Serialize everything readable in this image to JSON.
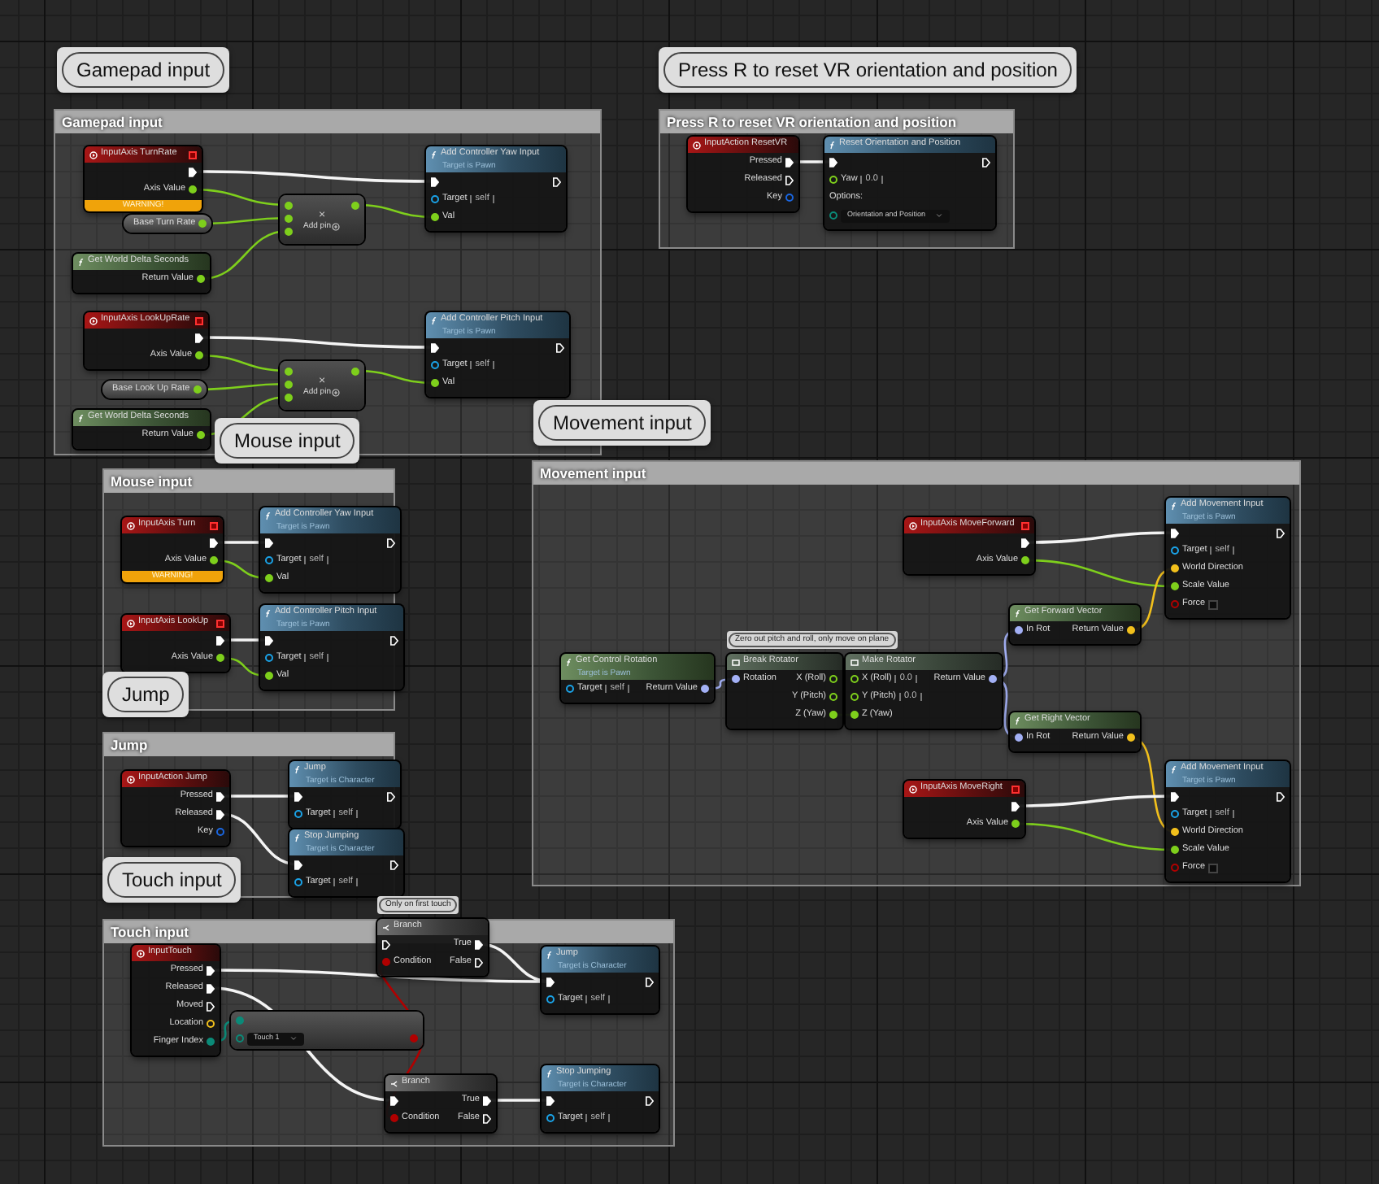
{
  "comments": [
    {
      "bubble": "Gamepad input",
      "title": "Gamepad input",
      "nodes": [
        {
          "kind": "event",
          "title": "InputAxis TurnRate",
          "delegate": true,
          "warning": "WARNING!",
          "rows": [
            {
              "out": {
                "kind": "exec",
                "linked": true
              }
            },
            {
              "out": {
                "kind": "float",
                "label": "Axis Value",
                "linked": true
              }
            }
          ]
        },
        {
          "kind": "getter",
          "title": "Base Turn Rate",
          "rows": [
            {
              "out": {
                "kind": "float",
                "linked": true
              }
            }
          ]
        },
        {
          "kind": "pure",
          "title": "Get World Delta Seconds",
          "rows": [
            {
              "out": {
                "kind": "float",
                "label": "Return Value",
                "linked": true
              }
            }
          ]
        },
        {
          "kind": "math",
          "symbol": "×",
          "action": "Add pin",
          "rows": [
            {
              "in": {
                "kind": "float",
                "linked": true
              },
              "out": {
                "kind": "float",
                "linked": true
              }
            },
            {
              "in": {
                "kind": "float",
                "linked": true
              }
            },
            {
              "in": {
                "kind": "float",
                "linked": true
              }
            }
          ]
        },
        {
          "kind": "function",
          "title": "Add Controller Yaw Input",
          "subtitle": "Target is Pawn",
          "rows": [
            {
              "in": {
                "kind": "exec",
                "linked": true
              },
              "out": {
                "kind": "exec",
                "linked": false
              }
            },
            {
              "in": {
                "kind": "object",
                "label": "Target",
                "value": "self",
                "linked": false
              }
            },
            {
              "in": {
                "kind": "float",
                "label": "Val",
                "linked": true
              }
            }
          ]
        },
        {
          "kind": "event",
          "title": "InputAxis LookUpRate",
          "delegate": true,
          "rows": [
            {
              "out": {
                "kind": "exec",
                "linked": true
              }
            },
            {
              "out": {
                "kind": "float",
                "label": "Axis Value",
                "linked": true
              }
            }
          ]
        },
        {
          "kind": "getter",
          "title": "Base Look Up Rate",
          "rows": [
            {
              "out": {
                "kind": "float",
                "linked": true
              }
            }
          ]
        },
        {
          "kind": "pure",
          "title": "Get World Delta Seconds",
          "rows": [
            {
              "out": {
                "kind": "float",
                "label": "Return Value",
                "linked": true
              }
            }
          ]
        },
        {
          "kind": "math",
          "symbol": "×",
          "action": "Add pin",
          "rows": [
            {
              "in": {
                "kind": "float",
                "linked": true
              },
              "out": {
                "kind": "float",
                "linked": true
              }
            },
            {
              "in": {
                "kind": "float",
                "linked": true
              }
            },
            {
              "in": {
                "kind": "float",
                "linked": true
              }
            }
          ]
        },
        {
          "kind": "function",
          "title": "Add Controller Pitch Input",
          "subtitle": "Target is Pawn",
          "rows": [
            {
              "in": {
                "kind": "exec",
                "linked": true
              },
              "out": {
                "kind": "exec",
                "linked": false
              }
            },
            {
              "in": {
                "kind": "object",
                "label": "Target",
                "value": "self",
                "linked": false
              }
            },
            {
              "in": {
                "kind": "float",
                "label": "Val",
                "linked": true
              }
            }
          ]
        }
      ]
    },
    {
      "bubble": "Press R to reset VR orientation and position",
      "title": "Press R to reset VR orientation and position",
      "nodes": [
        {
          "kind": "event",
          "title": "InputAction ResetVR",
          "delegate": false,
          "rows": [
            {
              "out": {
                "kind": "exec",
                "label": "Pressed",
                "linked": true
              }
            },
            {
              "out": {
                "kind": "exec",
                "label": "Released",
                "linked": false
              }
            },
            {
              "out": {
                "kind": "key",
                "label": "Key",
                "linked": false
              }
            }
          ]
        },
        {
          "kind": "function",
          "title": "Reset Orientation and Position",
          "rows": [
            {
              "in": {
                "kind": "exec",
                "linked": true
              },
              "out": {
                "kind": "exec",
                "linked": false
              }
            },
            {
              "in": {
                "kind": "float",
                "label": "Yaw",
                "value": "0.0",
                "linked": false
              }
            },
            {
              "in": {
                "kind": "label",
                "label": "Options:"
              }
            },
            {
              "in": {
                "kind": "byte",
                "dropdown": "Orientation and Position",
                "linked": false
              }
            }
          ]
        }
      ]
    },
    {
      "bubble": "Mouse input",
      "title": "Mouse input",
      "nodes": [
        {
          "kind": "event",
          "title": "InputAxis Turn",
          "delegate": true,
          "warning": "WARNING!",
          "rows": [
            {
              "out": {
                "kind": "exec",
                "linked": true
              }
            },
            {
              "out": {
                "kind": "float",
                "label": "Axis Value",
                "linked": true
              }
            }
          ]
        },
        {
          "kind": "function",
          "title": "Add Controller Yaw Input",
          "subtitle": "Target is Pawn",
          "rows": [
            {
              "in": {
                "kind": "exec",
                "linked": true
              },
              "out": {
                "kind": "exec",
                "linked": false
              }
            },
            {
              "in": {
                "kind": "object",
                "label": "Target",
                "value": "self",
                "linked": false
              }
            },
            {
              "in": {
                "kind": "float",
                "label": "Val",
                "linked": true
              }
            }
          ]
        },
        {
          "kind": "event",
          "title": "InputAxis LookUp",
          "delegate": true,
          "rows": [
            {
              "out": {
                "kind": "exec",
                "linked": true
              }
            },
            {
              "out": {
                "kind": "float",
                "label": "Axis Value",
                "linked": true
              }
            }
          ]
        },
        {
          "kind": "function",
          "title": "Add Controller Pitch Input",
          "subtitle": "Target is Pawn",
          "rows": [
            {
              "in": {
                "kind": "exec",
                "linked": true
              },
              "out": {
                "kind": "exec",
                "linked": false
              }
            },
            {
              "in": {
                "kind": "object",
                "label": "Target",
                "value": "self",
                "linked": false
              }
            },
            {
              "in": {
                "kind": "float",
                "label": "Val",
                "linked": true
              }
            }
          ]
        }
      ]
    },
    {
      "bubble": "Movement input",
      "title": "Movement input",
      "nodes": [
        {
          "kind": "pure",
          "title": "Get Control Rotation",
          "subtitle": "Target is Pawn",
          "rows": [
            {
              "in": {
                "kind": "object",
                "label": "Target",
                "value": "self",
                "linked": false
              },
              "out": {
                "kind": "rotator",
                "label": "Return Value",
                "linked": true
              }
            }
          ]
        },
        {
          "kind": "struct",
          "title": "Break Rotator",
          "comment": "Zero out pitch and roll, only move on plane",
          "rows": [
            {
              "in": {
                "kind": "rotator",
                "label": "Rotation",
                "linked": true
              },
              "out": {
                "kind": "float",
                "label": "X (Roll)",
                "linked": false
              }
            },
            {
              "out": {
                "kind": "float",
                "label": "Y (Pitch)",
                "linked": false
              }
            },
            {
              "out": {
                "kind": "float",
                "label": "Z (Yaw)",
                "linked": true
              }
            }
          ]
        },
        {
          "kind": "struct",
          "title": "Make Rotator",
          "rows": [
            {
              "in": {
                "kind": "float",
                "label": "X (Roll)",
                "value": "0.0",
                "linked": false
              },
              "out": {
                "kind": "rotator",
                "label": "Return Value",
                "linked": true
              }
            },
            {
              "in": {
                "kind": "float",
                "label": "Y (Pitch)",
                "value": "0.0",
                "linked": false
              }
            },
            {
              "in": {
                "kind": "float",
                "label": "Z (Yaw)",
                "linked": true
              }
            }
          ]
        },
        {
          "kind": "event",
          "title": "InputAxis MoveForward",
          "delegate": true,
          "rows": [
            {
              "out": {
                "kind": "exec",
                "linked": true
              }
            },
            {
              "out": {
                "kind": "float",
                "label": "Axis Value",
                "linked": true
              }
            }
          ]
        },
        {
          "kind": "function",
          "title": "Add Movement Input",
          "subtitle": "Target is Pawn",
          "rows": [
            {
              "in": {
                "kind": "exec",
                "linked": true
              },
              "out": {
                "kind": "exec",
                "linked": false
              }
            },
            {
              "in": {
                "kind": "object",
                "label": "Target",
                "value": "self",
                "linked": false
              }
            },
            {
              "in": {
                "kind": "vector",
                "label": "World Direction",
                "linked": true
              }
            },
            {
              "in": {
                "kind": "float",
                "label": "Scale Value",
                "linked": true
              }
            },
            {
              "in": {
                "kind": "bool",
                "label": "Force",
                "linked": false,
                "checked": false
              }
            }
          ]
        },
        {
          "kind": "pure",
          "title": "Get Forward Vector",
          "rows": [
            {
              "in": {
                "kind": "rotator",
                "label": "In Rot",
                "linked": true
              },
              "out": {
                "kind": "vector",
                "label": "Return Value",
                "linked": true
              }
            }
          ]
        },
        {
          "kind": "pure",
          "title": "Get Right Vector",
          "rows": [
            {
              "in": {
                "kind": "rotator",
                "label": "In Rot",
                "linked": true
              },
              "out": {
                "kind": "vector",
                "label": "Return Value",
                "linked": true
              }
            }
          ]
        },
        {
          "kind": "event",
          "title": "InputAxis MoveRight",
          "delegate": true,
          "rows": [
            {
              "out": {
                "kind": "exec",
                "linked": true
              }
            },
            {
              "out": {
                "kind": "float",
                "label": "Axis Value",
                "linked": true
              }
            }
          ]
        },
        {
          "kind": "function",
          "title": "Add Movement Input",
          "subtitle": "Target is Pawn",
          "rows": [
            {
              "in": {
                "kind": "exec",
                "linked": true
              },
              "out": {
                "kind": "exec",
                "linked": false
              }
            },
            {
              "in": {
                "kind": "object",
                "label": "Target",
                "value": "self",
                "linked": false
              }
            },
            {
              "in": {
                "kind": "vector",
                "label": "World Direction",
                "linked": true
              }
            },
            {
              "in": {
                "kind": "float",
                "label": "Scale Value",
                "linked": true
              }
            },
            {
              "in": {
                "kind": "bool",
                "label": "Force",
                "linked": false,
                "checked": false
              }
            }
          ]
        }
      ]
    },
    {
      "bubble": "Jump",
      "title": "Jump",
      "nodes": [
        {
          "kind": "event",
          "title": "InputAction Jump",
          "delegate": false,
          "rows": [
            {
              "out": {
                "kind": "exec",
                "label": "Pressed",
                "linked": true
              }
            },
            {
              "out": {
                "kind": "exec",
                "label": "Released",
                "linked": true
              }
            },
            {
              "out": {
                "kind": "key",
                "label": "Key",
                "linked": false
              }
            }
          ]
        },
        {
          "kind": "function",
          "title": "Jump",
          "subtitle": "Target is Character",
          "rows": [
            {
              "in": {
                "kind": "exec",
                "linked": true
              },
              "out": {
                "kind": "exec",
                "linked": false
              }
            },
            {
              "in": {
                "kind": "object",
                "label": "Target",
                "value": "self",
                "linked": false
              }
            }
          ]
        },
        {
          "kind": "function",
          "title": "Stop Jumping",
          "subtitle": "Target is Character",
          "rows": [
            {
              "in": {
                "kind": "exec",
                "linked": true
              },
              "out": {
                "kind": "exec",
                "linked": false
              }
            },
            {
              "in": {
                "kind": "object",
                "label": "Target",
                "value": "self",
                "linked": false
              }
            }
          ]
        }
      ]
    },
    {
      "bubble": "Touch input",
      "title": "Touch input",
      "nodes": [
        {
          "kind": "event",
          "title": "InputTouch",
          "delegate": false,
          "rows": [
            {
              "out": {
                "kind": "exec",
                "label": "Pressed",
                "linked": true
              }
            },
            {
              "out": {
                "kind": "exec",
                "label": "Released",
                "linked": true
              }
            },
            {
              "out": {
                "kind": "exec",
                "label": "Moved",
                "linked": false
              }
            },
            {
              "out": {
                "kind": "vector",
                "label": "Location",
                "linked": false
              }
            },
            {
              "out": {
                "kind": "byte",
                "label": "Finger Index",
                "linked": true
              }
            }
          ]
        },
        {
          "kind": "compare",
          "rows": [
            {
              "in": {
                "kind": "byte",
                "linked": true
              }
            },
            {
              "in": {
                "kind": "byte",
                "dropdown": "Touch 1",
                "linked": false
              },
              "out": {
                "kind": "bool",
                "linked": true
              }
            }
          ]
        },
        {
          "kind": "branch",
          "title": "Branch",
          "comment": "Only on first touch",
          "rows": [
            {
              "in": {
                "kind": "exec",
                "linked": false
              },
              "out": {
                "kind": "exec",
                "label": "True",
                "linked": true
              }
            },
            {
              "in": {
                "kind": "bool",
                "label": "Condition",
                "linked": true
              },
              "out": {
                "kind": "exec",
                "label": "False",
                "linked": false
              }
            }
          ]
        },
        {
          "kind": "function",
          "title": "Jump",
          "subtitle": "Target is Character",
          "rows": [
            {
              "in": {
                "kind": "exec",
                "linked": true
              },
              "out": {
                "kind": "exec",
                "linked": false
              }
            },
            {
              "in": {
                "kind": "object",
                "label": "Target",
                "value": "self",
                "linked": false
              }
            }
          ]
        },
        {
          "kind": "branch",
          "title": "Branch",
          "rows": [
            {
              "in": {
                "kind": "exec",
                "linked": true
              },
              "out": {
                "kind": "exec",
                "label": "True",
                "linked": true
              }
            },
            {
              "in": {
                "kind": "bool",
                "label": "Condition",
                "linked": true
              },
              "out": {
                "kind": "exec",
                "label": "False",
                "linked": false
              }
            }
          ]
        },
        {
          "kind": "function",
          "title": "Stop Jumping",
          "subtitle": "Target is Character",
          "rows": [
            {
              "in": {
                "kind": "exec",
                "linked": true
              },
              "out": {
                "kind": "exec",
                "linked": false
              }
            },
            {
              "in": {
                "kind": "object",
                "label": "Target",
                "value": "self",
                "linked": false
              }
            }
          ]
        }
      ]
    }
  ]
}
